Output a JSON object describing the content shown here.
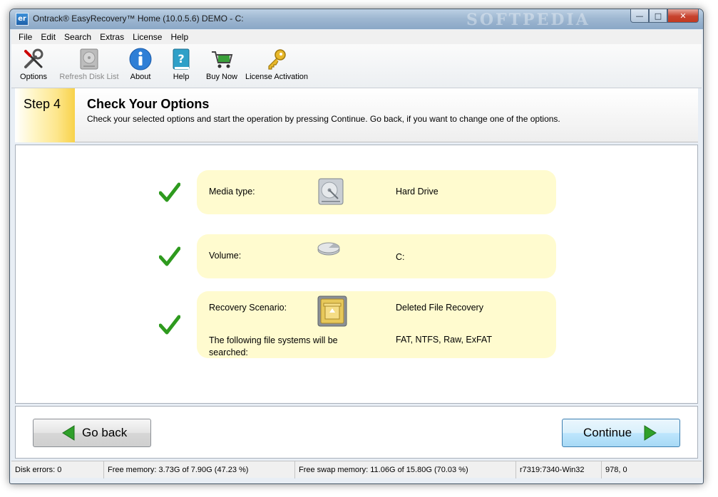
{
  "window": {
    "title": "Ontrack® EasyRecovery™ Home (10.0.5.6) DEMO - C:",
    "app_icon_text": "er",
    "watermark": "SOFTPEDIA",
    "controls": {
      "minimize": "—",
      "maximize": "□",
      "close": "✕"
    }
  },
  "menu": {
    "items": [
      {
        "label": "File"
      },
      {
        "label": "Edit"
      },
      {
        "label": "Search"
      },
      {
        "label": "Extras"
      },
      {
        "label": "License"
      },
      {
        "label": "Help"
      }
    ]
  },
  "toolbar": {
    "items": [
      {
        "label": "Options",
        "icon": "tools-icon",
        "enabled": true
      },
      {
        "label": "Refresh Disk List",
        "icon": "hard-disk-icon",
        "enabled": false
      },
      {
        "label": "About",
        "icon": "info-icon",
        "enabled": true
      },
      {
        "label": "Help",
        "icon": "help-book-icon",
        "enabled": true
      },
      {
        "label": "Buy Now",
        "icon": "shopping-cart-icon",
        "enabled": true
      },
      {
        "label": "License Activation",
        "icon": "key-icon",
        "enabled": true
      }
    ]
  },
  "step": {
    "number": "Step 4",
    "title": "Check Your Options",
    "subtitle": "Check your selected options and start the operation by pressing Continue. Go back, if you want to change one of the options."
  },
  "options": [
    {
      "label": "Media type:",
      "value": "Hard Drive",
      "icon": "hard-drive-icon"
    },
    {
      "label": "Volume:",
      "value": "C:",
      "icon": "volume-icon"
    },
    {
      "label": "Recovery Scenario:",
      "value": "Deleted File Recovery",
      "icon": "recycle-drive-icon",
      "extra_label": "The following file systems will be searched:",
      "extra_value": "FAT, NTFS, Raw, ExFAT"
    }
  ],
  "nav": {
    "back_label": "Go back",
    "continue_label": "Continue"
  },
  "status": {
    "disk_errors": "Disk errors: 0",
    "free_memory": "Free memory: 3.73G of 7.90G (47.23 %)",
    "free_swap": "Free swap memory: 11.06G of 15.80G (70.03 %)",
    "build": "r7319:7340-Win32",
    "coords": "978, 0"
  },
  "colors": {
    "card_bg": "#fffbcf",
    "check_green": "#2e9a1e",
    "step_badge": "#f8d24a"
  }
}
